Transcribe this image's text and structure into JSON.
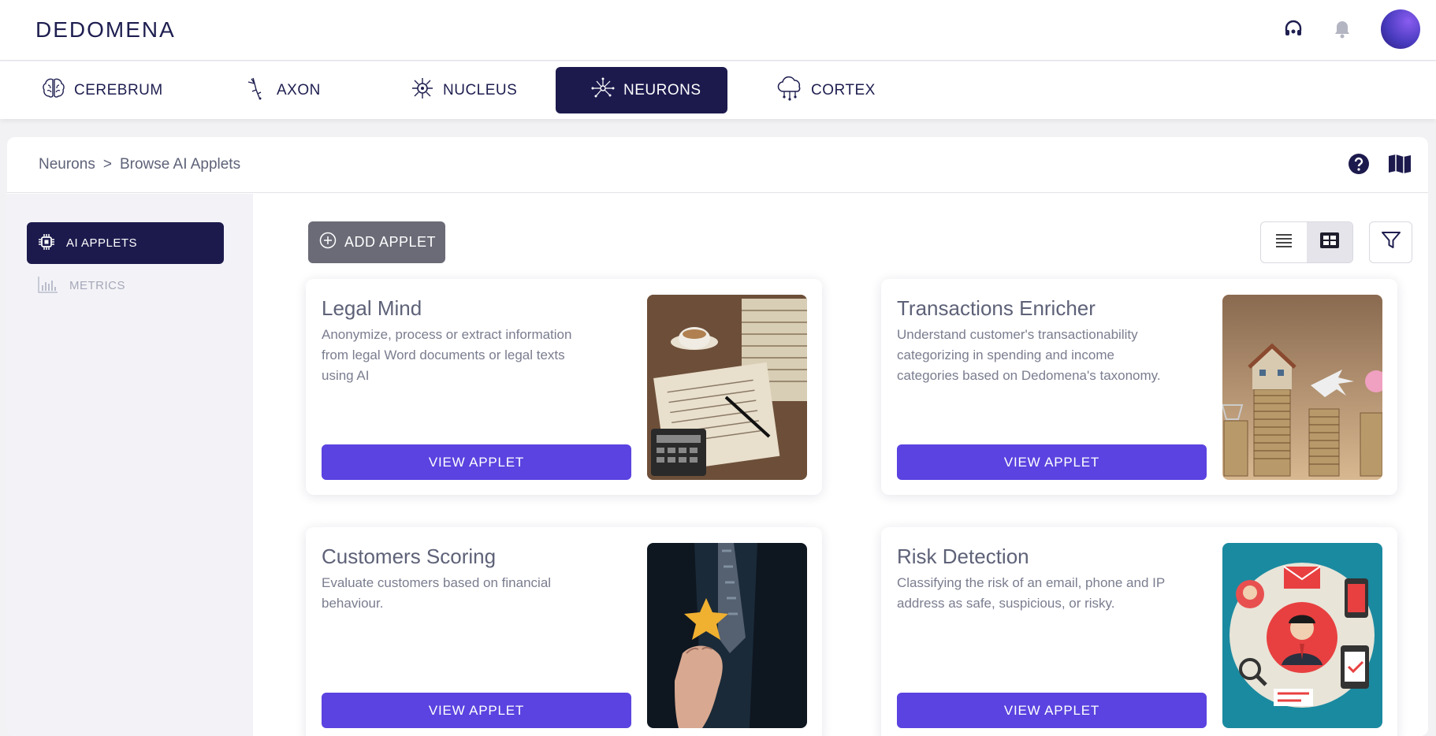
{
  "app": {
    "logo": "DEDOMENA"
  },
  "nav": {
    "items": [
      {
        "label": "CEREBRUM",
        "icon": "brain-icon"
      },
      {
        "label": "AXON",
        "icon": "axon-icon"
      },
      {
        "label": "NUCLEUS",
        "icon": "nucleus-icon"
      },
      {
        "label": "NEURONS",
        "icon": "neurons-icon",
        "active": true
      },
      {
        "label": "CORTEX",
        "icon": "cloud-network-icon"
      }
    ]
  },
  "breadcrumb": {
    "root": "Neurons",
    "separator": ">",
    "current": "Browse AI Applets"
  },
  "sidebar": {
    "items": [
      {
        "label": "AI APPLETS",
        "icon": "chip-icon",
        "active": true
      },
      {
        "label": "METRICS",
        "icon": "bar-chart-icon",
        "active": false
      }
    ]
  },
  "toolbar": {
    "add_label": "ADD APPLET"
  },
  "cards": [
    {
      "title": "Legal Mind",
      "description": "Anonymize, process or extract information from legal Word documents or legal texts using AI",
      "button": "VIEW APPLET"
    },
    {
      "title": "Transactions Enricher",
      "description": "Understand customer's transactionability categorizing in spending and income categories based on Dedomena's taxonomy.",
      "button": "VIEW APPLET"
    },
    {
      "title": "Customers Scoring",
      "description": "Evaluate customers based on financial behaviour.",
      "button": "VIEW APPLET"
    },
    {
      "title": "Risk Detection",
      "description": "Classifying the risk of an email, phone and IP address as safe, suspicious, or risky.",
      "button": "VIEW APPLET"
    }
  ],
  "colors": {
    "primary": "#5a43e0",
    "navy": "#1c1a4d",
    "grey_button": "#6b6b78"
  }
}
